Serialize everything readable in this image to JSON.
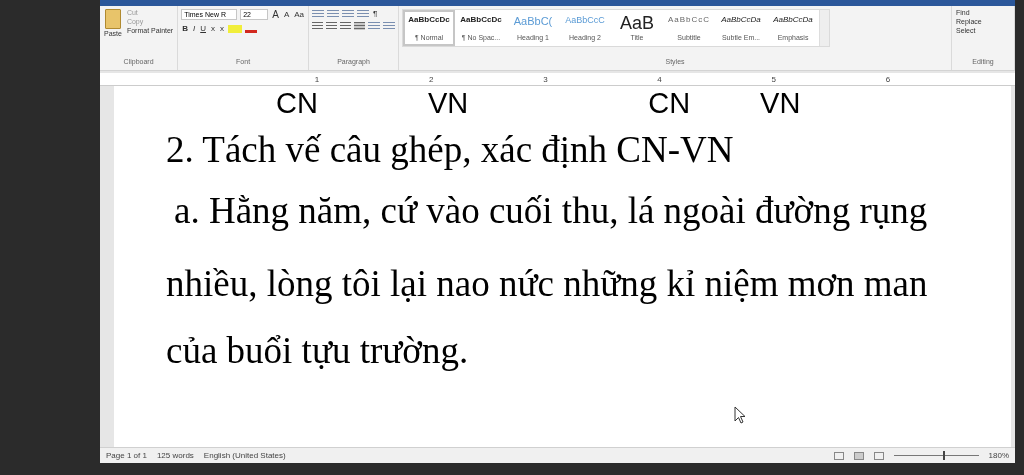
{
  "ribbon": {
    "clipboard": {
      "paste": "Paste",
      "cut": "Cut",
      "copy": "Copy",
      "format_painter": "Format Painter",
      "label": "Clipboard"
    },
    "font": {
      "name": "Times New R",
      "size": "22",
      "label": "Font",
      "bold": "B",
      "italic": "I",
      "underline": "U",
      "subscript": "x",
      "superscript": "x",
      "grow": "A",
      "shrink": "A",
      "case": "Aa"
    },
    "paragraph": {
      "label": "Paragraph",
      "pilcrow": "¶"
    },
    "styles": {
      "label": "Styles",
      "items": [
        {
          "preview": "AaBbCcDc",
          "name": "¶ Normal",
          "kind": "plain",
          "selected": true
        },
        {
          "preview": "AaBbCcDc",
          "name": "¶ No Spac...",
          "kind": "plain",
          "selected": false
        },
        {
          "preview": "AaBbC(",
          "name": "Heading 1",
          "kind": "heading",
          "selected": false
        },
        {
          "preview": "AaBbCcC",
          "name": "Heading 2",
          "kind": "heading2",
          "selected": false
        },
        {
          "preview": "AaB",
          "name": "Title",
          "kind": "title",
          "selected": false
        },
        {
          "preview": "AaBbCcC",
          "name": "Subtitle",
          "kind": "subtle",
          "selected": false
        },
        {
          "preview": "AaBbCcDa",
          "name": "Subtle Em...",
          "kind": "italic",
          "selected": false
        },
        {
          "preview": "AaBbCcDa",
          "name": "Emphasis",
          "kind": "italic",
          "selected": false
        }
      ]
    },
    "editing": {
      "label": "Editing",
      "find": "Find",
      "replace": "Replace",
      "select": "Select"
    }
  },
  "ruler": {
    "numbers": [
      "1",
      "2",
      "3",
      "4",
      "5",
      "6"
    ]
  },
  "document": {
    "labels_top": [
      "CN",
      "VN",
      "CN",
      "VN"
    ],
    "lines": [
      "2. Tách vế câu ghép, xác định CN-VN",
      "a. Hằng năm, cứ vào cuối thu, lá ngoài đường rụng",
      "nhiều, lòng tôi lại nao nức những kỉ niệm mơn man",
      "của buổi tựu trường."
    ]
  },
  "status_bar": {
    "page": "Page 1 of 1",
    "words": "125 words",
    "language": "English (United States)",
    "zoom": "180%",
    "zoom_level": {
      "level": 0.58
    }
  }
}
